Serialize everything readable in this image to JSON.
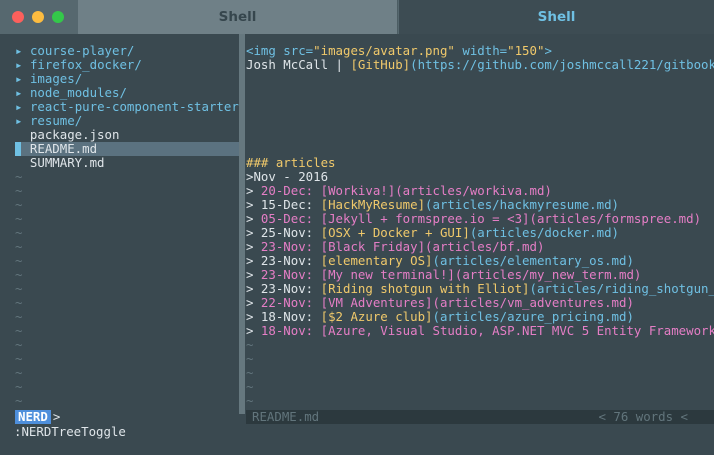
{
  "window": {
    "tabs": [
      {
        "label": "Shell",
        "active": false
      },
      {
        "label": "Shell",
        "active": true
      }
    ]
  },
  "tree": {
    "items": [
      {
        "type": "dir",
        "arrow": "▸",
        "name": "course-player/"
      },
      {
        "type": "dir",
        "arrow": "▸",
        "name": "firefox_docker/"
      },
      {
        "type": "dir",
        "arrow": "▸",
        "name": "images/"
      },
      {
        "type": "dir",
        "arrow": "▸",
        "name": "node_modules/"
      },
      {
        "type": "dir",
        "arrow": "▸",
        "name": "react-pure-component-starter/"
      },
      {
        "type": "dir",
        "arrow": "▸",
        "name": "resume/"
      },
      {
        "type": "file",
        "arrow": "",
        "name": "package.json"
      },
      {
        "type": "file",
        "arrow": "",
        "name": "README.md",
        "selected": true
      },
      {
        "type": "file",
        "arrow": "",
        "name": "SUMMARY.md"
      }
    ],
    "tilde": "~"
  },
  "editor": {
    "img_tag_open": "<img",
    "img_attr_src": " src=",
    "img_src_value": "\"images/avatar.png\"",
    "img_attr_width": " width=",
    "img_width_value": "\"150\"",
    "img_tag_close": ">",
    "author_line_prefix": "Josh McCall | ",
    "github_label": "[GitHub]",
    "github_url": "(https://github.com/joshmccall221/gitbook",
    "heading": "### articles",
    "month_heading": ">Nov - 2016",
    "articles": [
      {
        "date": "20-Dec:",
        "title": "[Workiva!]",
        "path": "(articles/workiva.md)",
        "color": "pink"
      },
      {
        "date": "15-Dec:",
        "title": "[HackMyResume]",
        "path": "(articles/hackmyresume.md)",
        "color": "white"
      },
      {
        "date": "05-Dec:",
        "title": "[Jekyll + formspree.io = <3]",
        "path": "(articles/formspree.md)",
        "color": "pink"
      },
      {
        "date": "25-Nov:",
        "title": "[OSX + Docker + GUI]",
        "path": "(articles/docker.md)",
        "color": "white"
      },
      {
        "date": "23-Nov:",
        "title": "[Black Friday]",
        "path": "(articles/bf.md)",
        "color": "pink"
      },
      {
        "date": "23-Nov:",
        "title": "[elementary OS]",
        "path": "(articles/elementary_os.md)",
        "color": "white"
      },
      {
        "date": "23-Nov:",
        "title": "[My new terminal!]",
        "path": "(articles/my_new_term.md)",
        "color": "pink"
      },
      {
        "date": "23-Nov:",
        "title": "[Riding shotgun with Elliot]",
        "path": "(articles/riding_shotgun_",
        "color": "white"
      },
      {
        "date": "22-Nov:",
        "title": "[VM Adventures]",
        "path": "(articles/vm_adventures.md)",
        "color": "pink"
      },
      {
        "date": "18-Nov:",
        "title": "[$2 Azure club]",
        "path": "(articles/azure_pricing.md)",
        "color": "white"
      },
      {
        "date": "18-Nov:",
        "title": "[Azure, Visual Studio, ASP.NET MVC 5 Entity Framework",
        "path": "",
        "color": "pink"
      }
    ],
    "bullet": "> "
  },
  "statusline": {
    "mode_badge": "NERD",
    "mode_sep": ">",
    "filename": "README.md",
    "word_count": "< 76 words <"
  },
  "cmdline": ":NERDTreeToggle",
  "colors": {
    "accent_blue": "#6fc0e3",
    "accent_pink": "#e57ec6",
    "accent_yellow": "#f0c96b",
    "background": "#3a4950"
  }
}
